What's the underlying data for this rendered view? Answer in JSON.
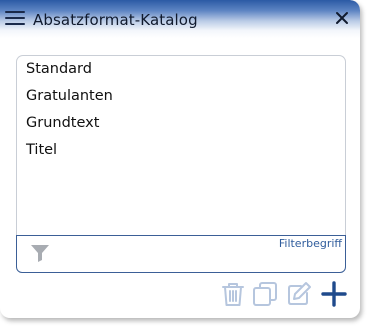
{
  "window": {
    "title": "Absatzformat-Katalog"
  },
  "list": {
    "items": [
      "Standard",
      "Gratulanten",
      "Grundtext",
      "Titel"
    ]
  },
  "filter": {
    "label": "Filterbegriff",
    "value": ""
  },
  "icons": {
    "menu": "hamburger-icon",
    "close": "close-icon",
    "filter": "funnel-icon",
    "delete": "trash-icon",
    "duplicate": "copy-icon",
    "edit": "pencil-icon",
    "add": "plus-icon"
  },
  "colors": {
    "title_bar_dark": "#2b5aa5",
    "accent": "#2f5c9c",
    "disabled_icon": "#b6c6de",
    "add_icon": "#1f4a8c"
  }
}
